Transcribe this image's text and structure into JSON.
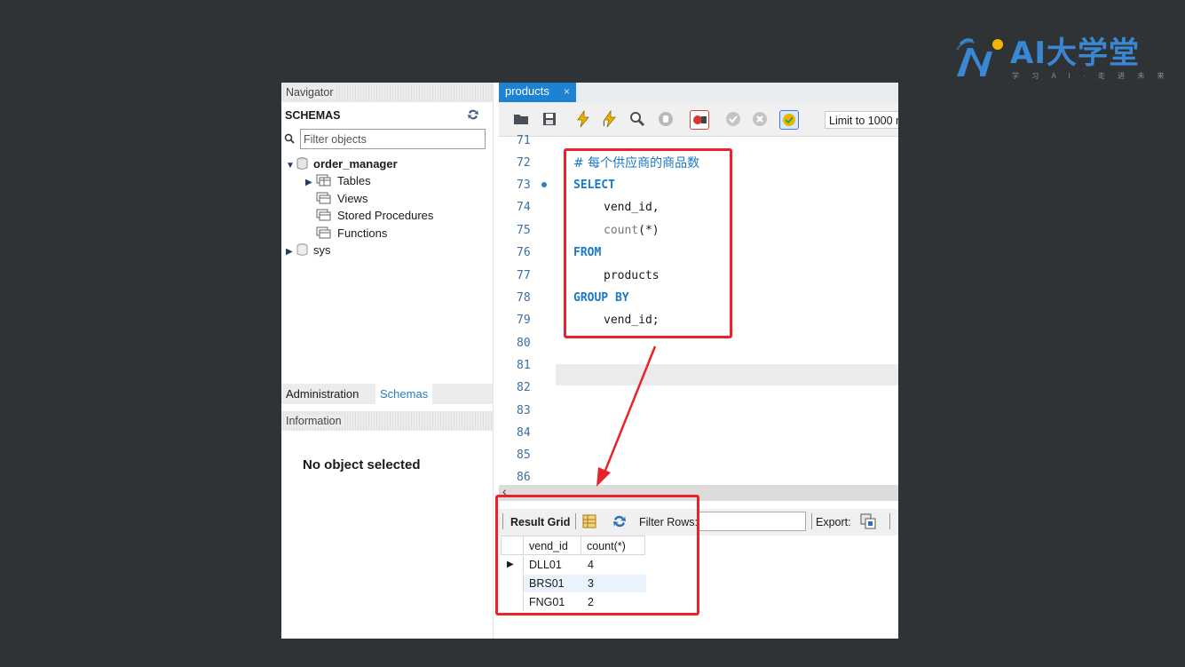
{
  "logo": {
    "brand": "AI大学堂",
    "slogan": "学 习 A I · 走 进 未 来"
  },
  "navigator": {
    "title": "Navigator",
    "schemas_label": "SCHEMAS",
    "filter_placeholder": "Filter objects",
    "tree": {
      "db1": "order_manager",
      "tables": "Tables",
      "views": "Views",
      "procedures": "Stored Procedures",
      "functions": "Functions",
      "db2": "sys"
    },
    "tabs": {
      "administration": "Administration",
      "schemas": "Schemas"
    },
    "info_title": "Information",
    "no_object": "No object selected"
  },
  "editor": {
    "tab_label": "products",
    "tab_close": "×",
    "limit_label": "Limit to 1000 r",
    "line_numbers": [
      "71",
      "72",
      "73",
      "74",
      "75",
      "76",
      "77",
      "78",
      "79",
      "80",
      "81",
      "82",
      "83",
      "84",
      "85",
      "86"
    ],
    "code": {
      "comment": "# 每个供应商的商品数",
      "select": "SELECT",
      "col1": "vend_id,",
      "fn": "count",
      "fn_args": "(*)",
      "from": "FROM",
      "table": "products",
      "groupby": "GROUP BY",
      "group_col": "vend_id;"
    }
  },
  "results": {
    "result_grid": "Result Grid",
    "filter_rows": "Filter Rows:",
    "export": "Export:",
    "columns": [
      "vend_id",
      "count(*)"
    ],
    "rows": [
      {
        "vend_id": "DLL01",
        "count": "4"
      },
      {
        "vend_id": "BRS01",
        "count": "3"
      },
      {
        "vend_id": "FNG01",
        "count": "2"
      }
    ]
  },
  "colors": {
    "accent": "#1e82d3",
    "highlight_box": "#e8232a",
    "background": "#303336"
  }
}
